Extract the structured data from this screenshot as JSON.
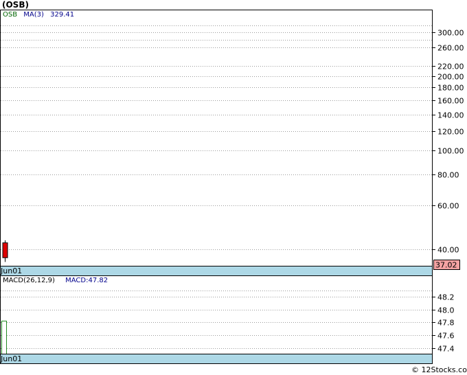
{
  "title": "(OSB)",
  "watermark": "© 12Stocks.com",
  "colors": {
    "background": "#ffffff",
    "panel_border": "#000000",
    "date_strip": "#add8e6",
    "candle_down": "#dd0000",
    "macd_bar": "#228b22",
    "ticker_label": "#006400",
    "ma_label": "#00008b",
    "last_price_box": "#f4a3a3"
  },
  "chart_data": [
    {
      "type": "candlestick",
      "title": "(OSB)",
      "ticker": "OSB",
      "scale": "log",
      "ylim": [
        35,
        330
      ],
      "yticks": [
        40,
        60,
        80,
        100,
        120,
        140,
        160,
        180,
        200,
        220,
        260,
        300
      ],
      "ytick_labels": [
        "40.00",
        "60.00",
        "80.00",
        "100.00",
        "120.00",
        "140.00",
        "160.00",
        "180.00",
        "200.00",
        "220.00",
        "260.00",
        "300.00"
      ],
      "minor_gridlines": [
        280,
        320
      ],
      "dates": [
        "Jun01"
      ],
      "candles": [
        {
          "date": "Jun01",
          "open": 42.5,
          "high": 43.5,
          "low": 35.6,
          "close": 37.02
        }
      ],
      "legend": {
        "ticker_label": "OSB",
        "ma_label": "MA(3)",
        "ma_value": "329.41"
      },
      "last_price": "37.02",
      "x_date_label": "Jun01"
    },
    {
      "type": "bar",
      "title": "MACD(26,12,9)",
      "ylim": [
        47.3,
        48.35
      ],
      "yticks": [
        47.4,
        47.6,
        47.8,
        48.0,
        48.2
      ],
      "ytick_labels": [
        "47.4",
        "47.6",
        "47.8",
        "48.0",
        "48.2"
      ],
      "minor_gridlines": [
        48.3
      ],
      "bars": [
        {
          "date": "Jun01",
          "value": 47.82
        }
      ],
      "legend": {
        "label": "MACD(26,12,9)",
        "value_label": "MACD:47.82"
      },
      "x_date_label": "Jun01"
    }
  ]
}
